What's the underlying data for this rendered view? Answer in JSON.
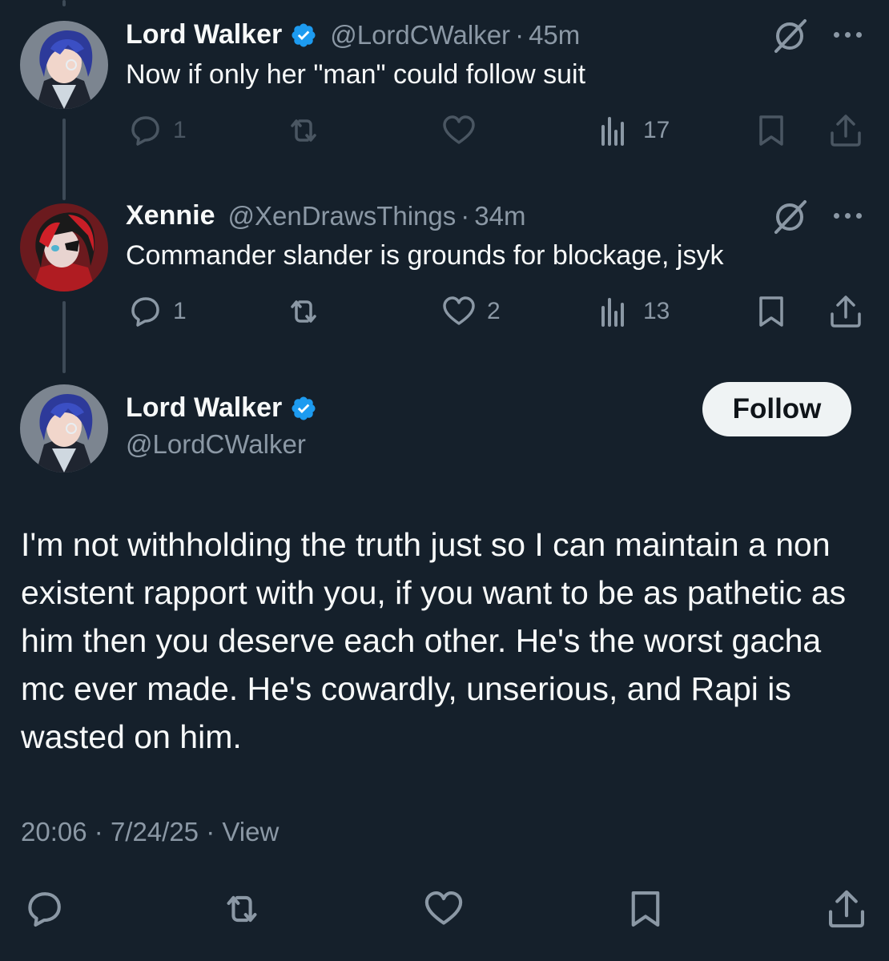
{
  "tweets": [
    {
      "name": "Lord Walker",
      "handle": "@LordCWalker",
      "sep": "·",
      "time": "45m",
      "text": "Now if only her \"man\" could follow suit",
      "replies": "1",
      "likes": "",
      "views": "17"
    },
    {
      "name": "Xennie",
      "handle": "@XenDrawsThings",
      "sep": "·",
      "time": "34m",
      "text": "Commander slander is grounds for blockage, jsyk",
      "replies": "1",
      "likes": "2",
      "views": "13"
    }
  ],
  "main": {
    "name": "Lord Walker",
    "handle": "@LordCWalker",
    "follow_label": "Follow",
    "text": "I'm not withholding the truth just so I can maintain a non existent rapport with you, if you want to be as pathetic as him then you deserve each other. He's the worst gacha mc ever made. He's cowardly, unserious, and Rapi is wasted on him.",
    "time": "20:06",
    "sep": "·",
    "date": "7/24/25",
    "views_link": "View"
  },
  "colors": {
    "background": "#15202b",
    "verified": "#1d9bf0",
    "muted": "#8b98a5",
    "follow_bg": "#eff3f4"
  },
  "icons": [
    "verified-badge-icon",
    "grok-slash-icon",
    "more-dots-icon",
    "reply-icon",
    "repost-icon",
    "like-icon",
    "views-icon",
    "bookmark-icon",
    "share-icon"
  ]
}
